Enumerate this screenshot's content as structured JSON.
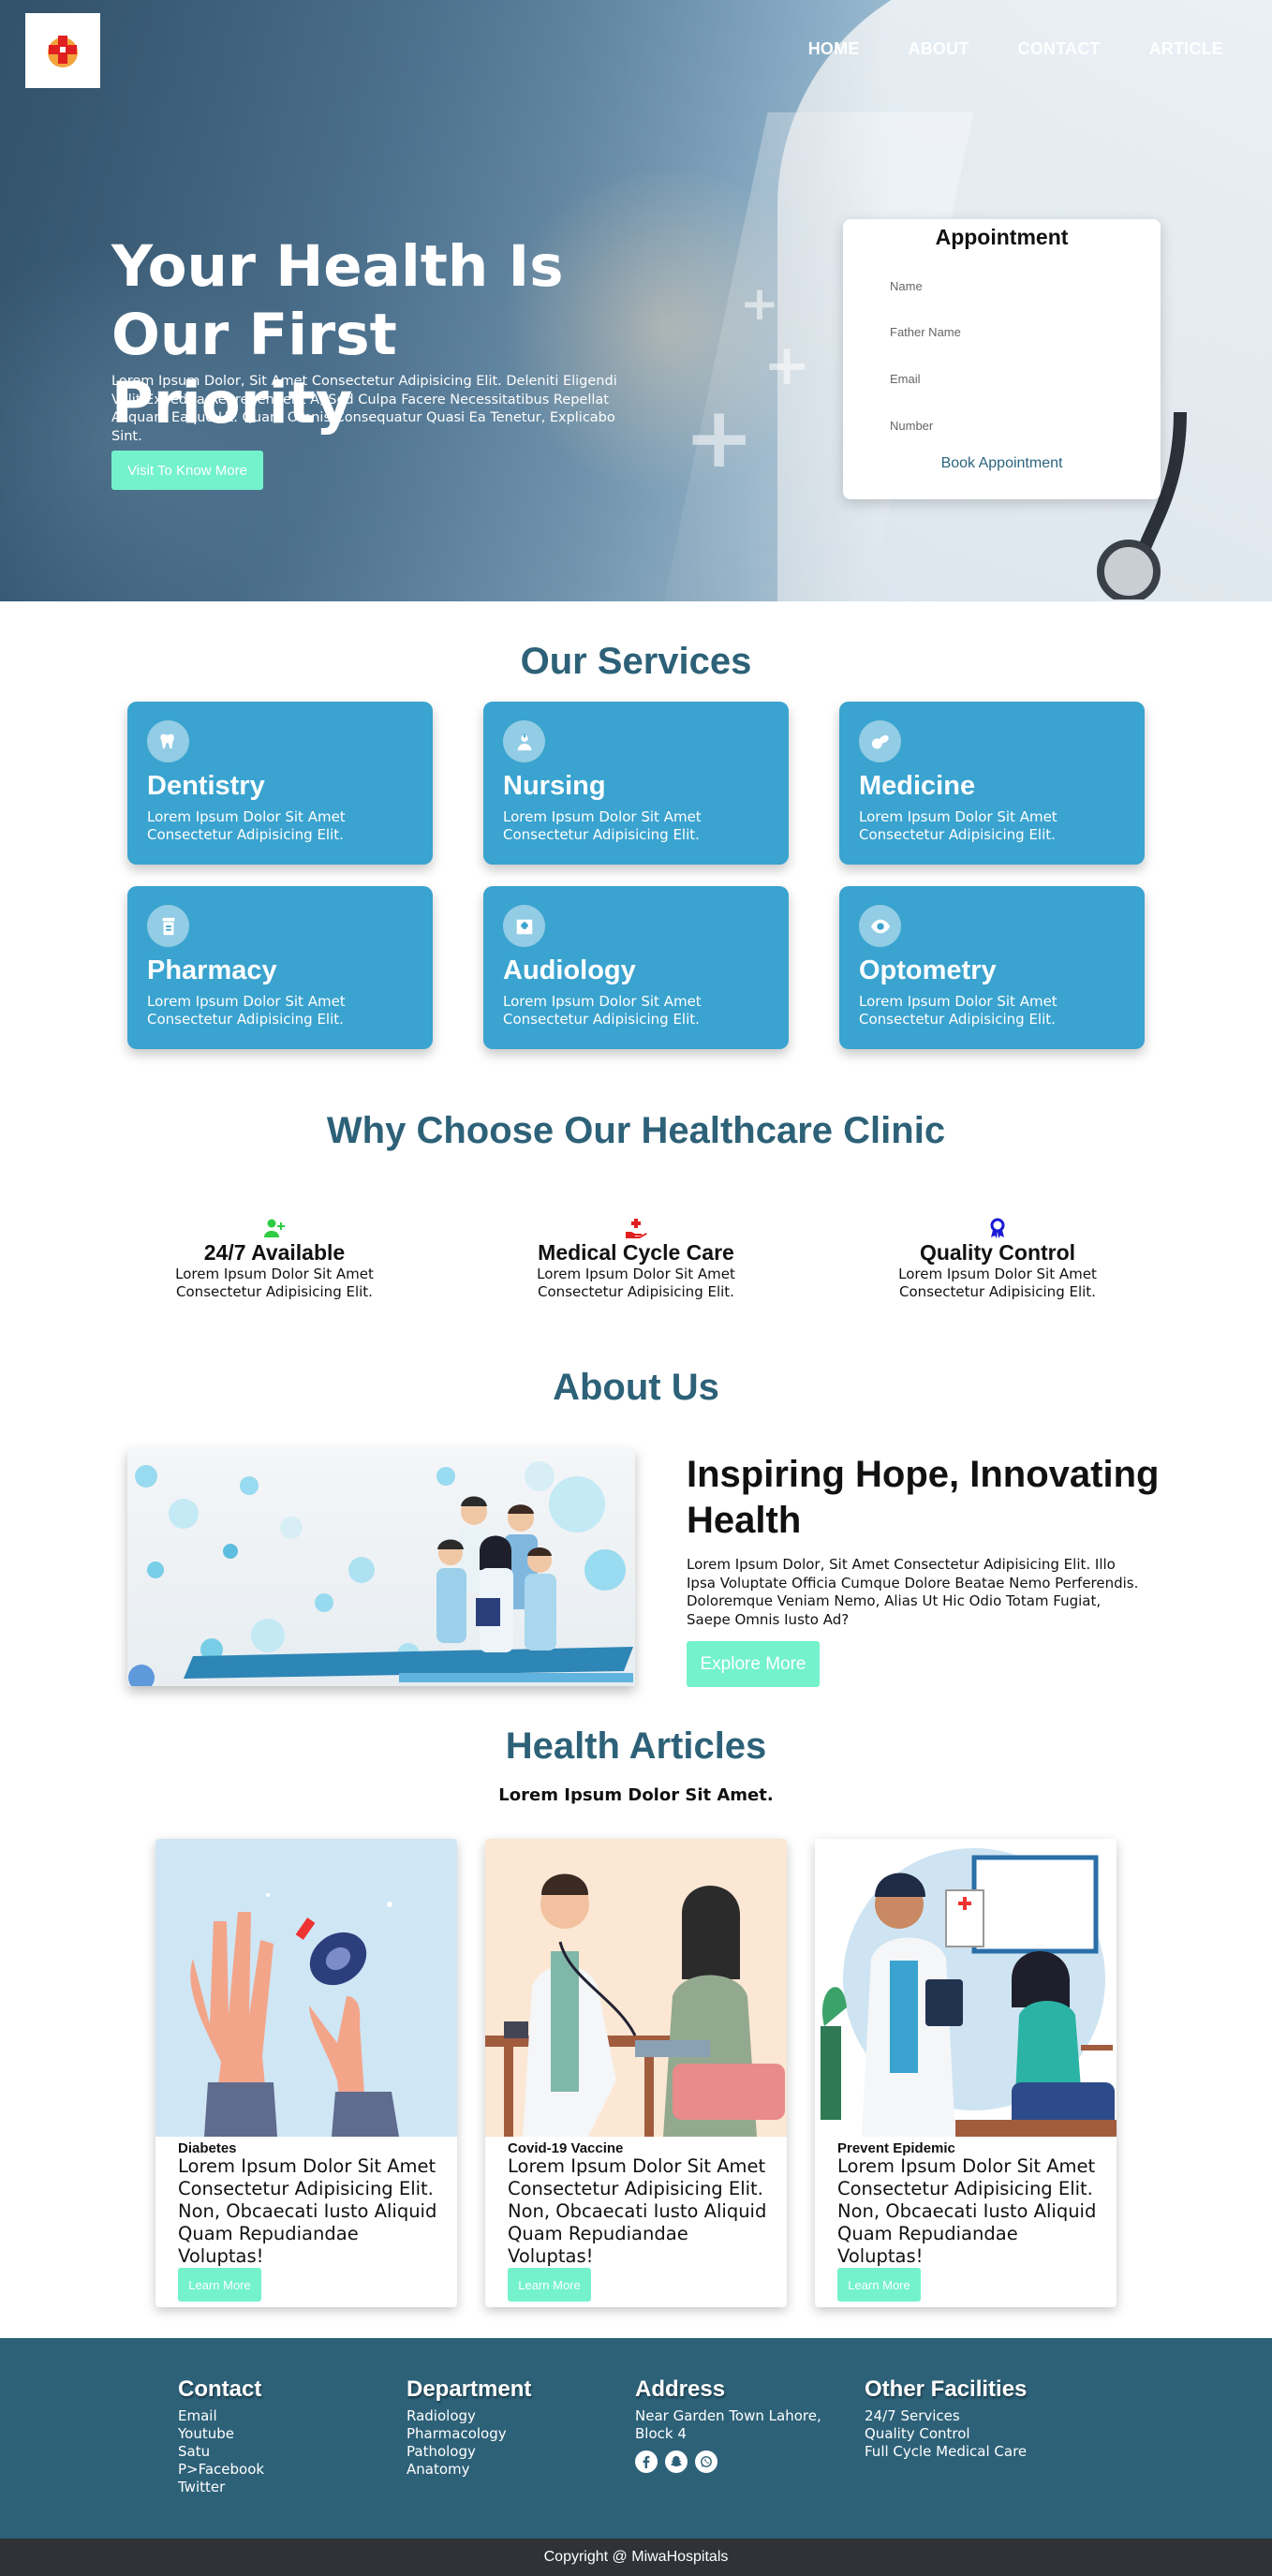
{
  "nav": {
    "home": "HOME",
    "about": "ABOUT",
    "contact": "CONTACT",
    "article": "ARTICLE"
  },
  "hero": {
    "title": "Your Health Is Our First Priority",
    "text": "Lorem Ipsum Dolor, Sit Amet Consectetur Adipisicing Elit. Deleniti Eligendi Velit Expedita Reprehenderit A, Sed Culpa Facere Necessitatibus Repellat Aliquam Eaque Ut. Quam Omnis Consequatur Quasi Ea Tenetur, Explicabo Sint.",
    "button": "Visit To Know More"
  },
  "appointment": {
    "title": "Appointment",
    "name_placeholder": "Name",
    "father_placeholder": "Father Name",
    "email_placeholder": "Email",
    "number_placeholder": "Number",
    "button": "Book Appointment"
  },
  "services": {
    "title": "Our Services",
    "items": [
      {
        "name": "Dentistry",
        "text": "Lorem Ipsum Dolor Sit Amet Consectetur Adipisicing Elit.",
        "icon": "tooth-icon"
      },
      {
        "name": "Nursing",
        "text": "Lorem Ipsum Dolor Sit Amet Consectetur Adipisicing Elit.",
        "icon": "nurse-icon"
      },
      {
        "name": "Medicine",
        "text": "Lorem Ipsum Dolor Sit Amet Consectetur Adipisicing Elit.",
        "icon": "pills-icon"
      },
      {
        "name": "Pharmacy",
        "text": "Lorem Ipsum Dolor Sit Amet Consectetur Adipisicing Elit.",
        "icon": "prescription-bottle-icon"
      },
      {
        "name": "Audiology",
        "text": "Lorem Ipsum Dolor Sit Amet Consectetur Adipisicing Elit.",
        "icon": "clinic-icon"
      },
      {
        "name": "Optometry",
        "text": "Lorem Ipsum Dolor Sit Amet Consectetur Adipisicing Elit.",
        "icon": "eye-icon"
      }
    ]
  },
  "why": {
    "title": "Why Choose Our Healthcare Clinic",
    "items": [
      {
        "name": "24/7 Available",
        "text": "Lorem Ipsum Dolor Sit Amet Consectetur Adipisicing Elit.",
        "icon": "user-plus-icon",
        "color": "#2ecc40"
      },
      {
        "name": "Medical Cycle Care",
        "text": "Lorem Ipsum Dolor Sit Amet Consectetur Adipisicing Elit.",
        "icon": "hand-holding-medical-icon",
        "color": "#e02020"
      },
      {
        "name": "Quality Control",
        "text": "Lorem Ipsum Dolor Sit Amet Consectetur Adipisicing Elit.",
        "icon": "award-icon",
        "color": "#1a1ad6"
      }
    ]
  },
  "about": {
    "title": "About Us",
    "heading": "Inspiring Hope, Innovating Health",
    "text": "Lorem Ipsum Dolor, Sit Amet Consectetur Adipisicing Elit. Illo Ipsa Voluptate Officia Cumque Dolore Beatae Nemo Perferendis. Doloremque Veniam Nemo, Alias Ut Hic Odio Totam Fugiat, Saepe Omnis Iusto Ad?",
    "button": "Explore More"
  },
  "articles": {
    "title": "Health Articles",
    "subtitle": "Lorem Ipsum Dolor Sit Amet.",
    "items": [
      {
        "category": "Diabetes",
        "text": "Lorem Ipsum Dolor Sit Amet Consectetur Adipisicing Elit. Non, Obcaecati Iusto Aliquid Quam Repudiandae Voluptas!",
        "button": "Learn More"
      },
      {
        "category": "Covid-19 Vaccine",
        "text": "Lorem Ipsum Dolor Sit Amet Consectetur Adipisicing Elit. Non, Obcaecati Iusto Aliquid Quam Repudiandae Voluptas!",
        "button": "Learn More"
      },
      {
        "category": "Prevent Epidemic",
        "text": "Lorem Ipsum Dolor Sit Amet Consectetur Adipisicing Elit. Non, Obcaecati Iusto Aliquid Quam Repudiandae Voluptas!",
        "button": "Learn More"
      }
    ]
  },
  "footer": {
    "contact": {
      "title": "Contact",
      "links": [
        "Email",
        "Youtube",
        "Satu",
        "P>Facebook",
        "Twitter"
      ]
    },
    "department": {
      "title": "Department",
      "links": [
        "Radiology",
        "Pharmacology",
        "Pathology",
        "Anatomy"
      ]
    },
    "address": {
      "title": "Address",
      "text": "Near Garden Town Lahore, Block 4",
      "icons": [
        "facebook-icon",
        "snapchat-icon",
        "whatsapp-icon"
      ]
    },
    "facilities": {
      "title": "Other Facilities",
      "links": [
        "24/7 Services",
        "Quality Control",
        "Full Cycle Medical Care"
      ]
    }
  },
  "copyright": "Copyright @ MiwaHospitals",
  "colors": {
    "primary": "#2d6178",
    "card": "#3aa3cf",
    "mint": "#74f2cc",
    "copyright_bg": "#2f3237"
  }
}
